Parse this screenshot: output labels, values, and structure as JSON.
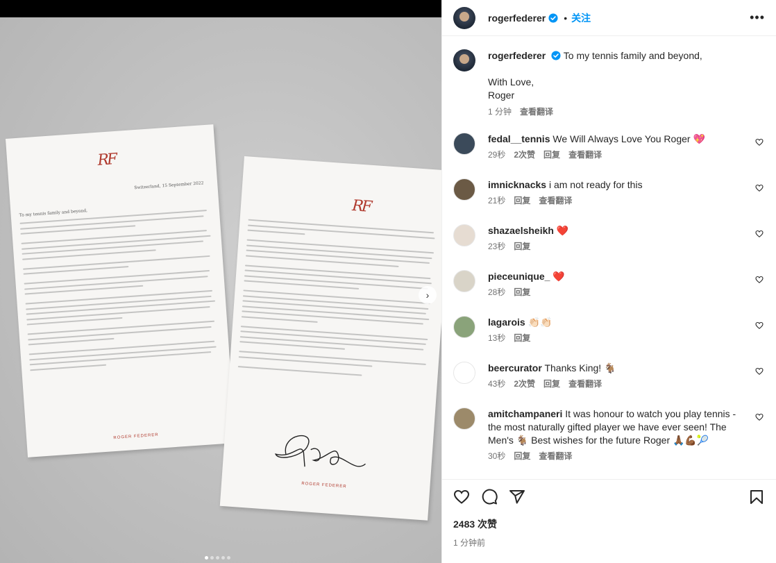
{
  "post": {
    "username": "rogerfederer",
    "follow_label": "关注",
    "separator": "•",
    "more": "•••",
    "caption": {
      "text_line1": "To my tennis family and beyond,",
      "text_line2": "With Love,",
      "text_line3": "Roger",
      "time": "1 分钟",
      "translate": "查看翻译"
    },
    "likes": "2483 次赞",
    "posted": "1 分钟前"
  },
  "letter": {
    "logo": "RF",
    "date": "Switzerland, 15 September 2022",
    "salutation": "To my tennis family and beyond,",
    "signature_name": "ROGER FEDERER"
  },
  "comments": [
    {
      "username": "fedal__tennis",
      "text": "We Will Always Love You Roger 💖",
      "time": "29秒",
      "likes": "2次赞",
      "reply": "回复",
      "translate": "查看翻译",
      "avatar_color": "#3b4a5a"
    },
    {
      "username": "imnicknacks",
      "text": "i am not ready for this",
      "time": "21秒",
      "likes": "",
      "reply": "回复",
      "translate": "查看翻译",
      "avatar_color": "#6b5a45"
    },
    {
      "username": "shazaelsheikh",
      "text": "❤️",
      "time": "23秒",
      "likes": "",
      "reply": "回复",
      "translate": "",
      "avatar_color": "#e6dcd2"
    },
    {
      "username": "pieceunique_",
      "text": "❤️",
      "time": "28秒",
      "likes": "",
      "reply": "回复",
      "translate": "",
      "avatar_color": "#d9d4c8"
    },
    {
      "username": "lagarois",
      "text": "👏🏻👏🏻",
      "time": "13秒",
      "likes": "",
      "reply": "回复",
      "translate": "",
      "avatar_color": "#8aa37a"
    },
    {
      "username": "beercurator",
      "text": "Thanks King! 🐐",
      "time": "43秒",
      "likes": "2次赞",
      "reply": "回复",
      "translate": "查看翻译",
      "avatar_color": "#ffffff"
    },
    {
      "username": "amitchampaneri",
      "text": "It was honour to watch you play tennis - the most naturally gifted player we have ever seen! The Men's 🐐 Best wishes for the future Roger 🙏🏾💪🏾🎾",
      "time": "30秒",
      "likes": "",
      "reply": "回复",
      "translate": "查看翻译",
      "avatar_color": "#9c8a6a"
    }
  ],
  "colors": {
    "accent": "#0095f6",
    "verified": "#0095f6",
    "muted": "#737373",
    "heart": "#ed4956",
    "logo_red": "#b03a2e"
  },
  "media": {
    "next_icon": "chevron-right-icon",
    "dots_total": 5,
    "dots_active": 1
  }
}
